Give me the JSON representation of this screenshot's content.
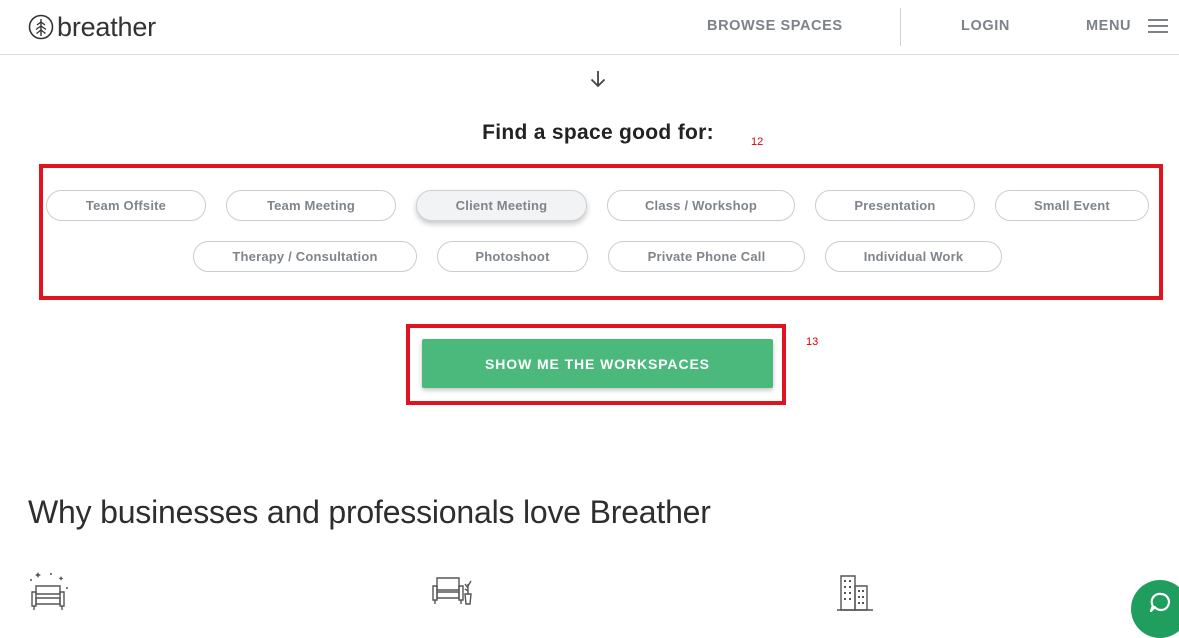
{
  "header": {
    "logo_text": "breather",
    "nav": {
      "browse": "BROWSE SPACES",
      "login": "LOGIN",
      "menu": "MENU"
    }
  },
  "finder": {
    "title": "Find a space good for:",
    "annotation_label": "12",
    "selected": "Client Meeting",
    "options": [
      "Team Offsite",
      "Team Meeting",
      "Client Meeting",
      "Class / Workshop",
      "Presentation",
      "Small Event",
      "Therapy / Consultation",
      "Photoshoot",
      "Private Phone Call",
      "Individual Work"
    ]
  },
  "cta": {
    "label": "SHOW ME THE WORKSPACES",
    "annotation_label": "13"
  },
  "why": {
    "heading": "Why businesses and professionals love Breather",
    "icons": [
      "sparkling-chair-icon",
      "sofa-plant-icon",
      "city-buildings-icon"
    ]
  },
  "chat": {
    "icon": "chat-bubble-icon"
  },
  "colors": {
    "accent_green": "#4bb87c",
    "chat_green": "#1f9e5e",
    "annotation_red": "#e0141e",
    "nav_gray": "#7c8289"
  }
}
